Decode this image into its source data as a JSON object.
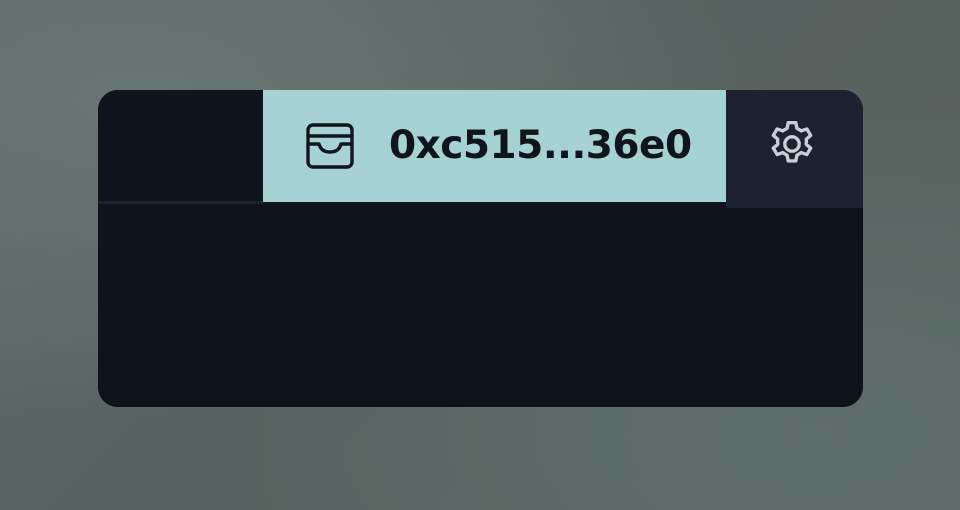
{
  "wallet": {
    "address": "0xc515...36e0",
    "icon": "wallet-icon"
  },
  "settings": {
    "icon": "gear-icon"
  },
  "colors": {
    "wallet_button_bg": "#a6d2d3",
    "panel_bg": "#0e131b",
    "text_dark": "#10151d",
    "icon_light": "#c9ced6"
  }
}
